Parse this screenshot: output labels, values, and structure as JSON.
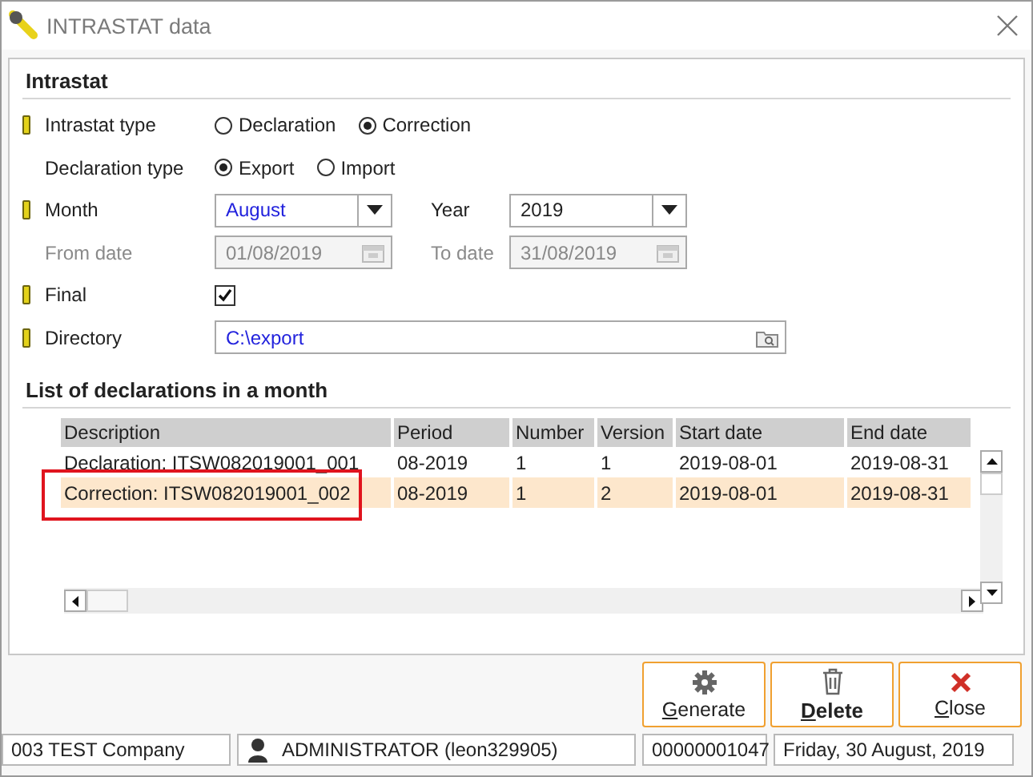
{
  "window": {
    "title": "INTRASTAT data"
  },
  "section_title": "Intrastat",
  "intrastat_type": {
    "label": "Intrastat type",
    "required": true,
    "options": [
      {
        "label": "Declaration",
        "selected": false
      },
      {
        "label": "Correction",
        "selected": true
      }
    ]
  },
  "declaration_type": {
    "label": "Declaration type",
    "required": false,
    "options": [
      {
        "label": "Export",
        "selected": true
      },
      {
        "label": "Import",
        "selected": false
      }
    ]
  },
  "month": {
    "label": "Month",
    "required": true,
    "value": "August"
  },
  "year": {
    "label": "Year",
    "value": "2019"
  },
  "from_date": {
    "label": "From date",
    "value": "01/08/2019",
    "disabled": true
  },
  "to_date": {
    "label": "To date",
    "value": "31/08/2019",
    "disabled": true
  },
  "final": {
    "label": "Final",
    "required": true,
    "checked": true
  },
  "directory": {
    "label": "Directory",
    "required": true,
    "value": "C:\\export"
  },
  "list_title": "List of declarations in a month",
  "table": {
    "columns": [
      "Description",
      "Period",
      "Number",
      "Version",
      "Start date",
      "End date"
    ],
    "rows": [
      {
        "cells": [
          "Declaration: ITSW082019001_001",
          "08-2019",
          "1",
          "1",
          "2019-08-01",
          "2019-08-31"
        ],
        "selected": false,
        "marked": false
      },
      {
        "cells": [
          "Correction: ITSW082019001_002",
          "08-2019",
          "1",
          "2",
          "2019-08-01",
          "2019-08-31"
        ],
        "selected": true,
        "marked": true
      }
    ]
  },
  "buttons": [
    {
      "kind": "generate",
      "label": "Generate"
    },
    {
      "kind": "delete",
      "label": "Delete"
    },
    {
      "kind": "close",
      "label": "Close"
    }
  ],
  "status_bar": {
    "company": "003 TEST Company",
    "user": "ADMINISTRATOR (leon329905)",
    "number": "00000001047",
    "date": "Friday, 30 August, 2019"
  }
}
